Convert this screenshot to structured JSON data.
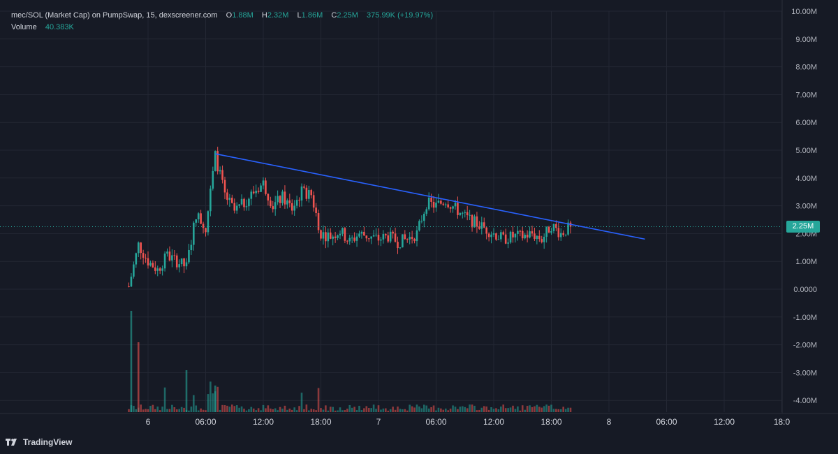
{
  "header": {
    "symbol": "mec/SOL (Market Cap) on PumpSwap, 15, dexscreener.com",
    "o_label": "O",
    "o_value": "1.88M",
    "h_label": "H",
    "h_value": "2.32M",
    "l_label": "L",
    "l_value": "1.86M",
    "c_label": "C",
    "c_value": "2.25M",
    "change": "375.99K (+19.97%)",
    "volume_label": "Volume",
    "volume_value": "40.383K"
  },
  "last_price_tag": "2.25M",
  "brand": "TradingView",
  "colors": {
    "up": "#26a69a",
    "down": "#ef5350",
    "trendline": "#2962ff",
    "background": "#161a25",
    "grid": "#232733"
  },
  "chart_data": {
    "type": "candlestick",
    "title": "",
    "xlabel": "",
    "ylabel": "",
    "y_unit": "Market Cap (SOL)",
    "y_ticks": [
      "10.00M",
      "9.00M",
      "8.00M",
      "7.00M",
      "6.00M",
      "5.00M",
      "4.00M",
      "3.00M",
      "2.00M",
      "1.00M",
      "0.0000",
      "-1.00M",
      "-2.00M",
      "-3.00M",
      "-4.00M"
    ],
    "x_ticks": [
      "6",
      "06:00",
      "12:00",
      "18:00",
      "7",
      "06:00",
      "12:00",
      "18:00",
      "8",
      "06:00",
      "12:00",
      "18:0"
    ],
    "ylim": [
      -4.25,
      10.0
    ],
    "grid": true,
    "last_close": 2.25,
    "trendline": {
      "from": {
        "time": "day6 07:00",
        "value": 4.87
      },
      "to": {
        "time": "day8 03:45",
        "value": 1.8
      }
    },
    "price_path": {
      "description": "approximate close path in millions, 15-minute candles",
      "times": [
        "day5 22:00",
        "day5 23:00",
        "day6 00:00",
        "day6 01:00",
        "day6 02:00",
        "day6 03:00",
        "day6 04:00",
        "day6 05:00",
        "day6 06:00",
        "day6 07:00",
        "day6 08:00",
        "day6 09:00",
        "day6 10:00",
        "day6 11:00",
        "day6 12:00",
        "day6 13:00",
        "day6 14:00",
        "day6 15:00",
        "day6 16:00",
        "day6 17:00",
        "day6 18:00",
        "day6 19:00",
        "day6 20:00",
        "day6 21:00",
        "day6 22:00",
        "day6 23:00",
        "day7 00:00",
        "day7 01:00",
        "day7 02:00",
        "day7 03:00",
        "day7 04:00",
        "day7 05:00",
        "day7 06:00",
        "day7 07:00",
        "day7 08:00",
        "day7 09:00",
        "day7 10:00",
        "day7 11:00",
        "day7 12:00",
        "day7 13:00",
        "day7 14:00",
        "day7 15:00",
        "day7 16:00",
        "day7 17:00",
        "day7 18:00",
        "day7 19:00",
        "day7 20:00"
      ],
      "values": [
        0.1,
        1.6,
        1.0,
        0.7,
        1.2,
        1.0,
        0.8,
        2.7,
        2.2,
        4.8,
        3.4,
        2.8,
        3.1,
        3.5,
        3.8,
        3.0,
        3.3,
        2.9,
        3.5,
        3.4,
        2.0,
        1.9,
        2.1,
        1.7,
        2.0,
        1.9,
        1.8,
        1.9,
        1.7,
        1.8,
        2.0,
        3.1,
        3.0,
        3.2,
        2.9,
        2.6,
        2.4,
        2.2,
        2.0,
        1.8,
        1.9,
        1.9,
        2.0,
        1.8,
        2.3,
        2.0,
        2.25
      ]
    },
    "volume": {
      "last_value": "40.383K",
      "notable_spikes": [
        "day5 22:15",
        "day5 23:00",
        "day6 04:00",
        "day6 07:00"
      ]
    }
  }
}
